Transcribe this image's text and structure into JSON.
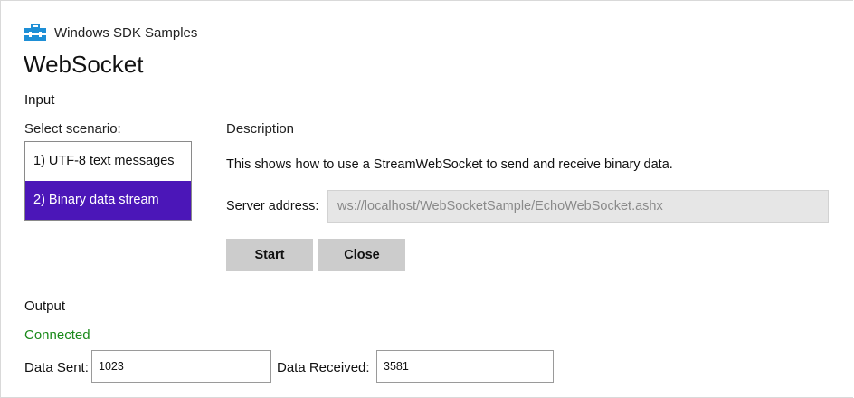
{
  "header": {
    "app_title": "Windows SDK Samples",
    "icon": "toolbox-icon",
    "page_title": "WebSocket"
  },
  "input": {
    "section_label": "Input",
    "scenario_label": "Select scenario:",
    "scenarios": [
      {
        "label": "1) UTF-8 text messages",
        "selected": false
      },
      {
        "label": "2) Binary data stream",
        "selected": true
      }
    ],
    "description_label": "Description",
    "description_text": "This shows how to use a StreamWebSocket to send and receive binary data.",
    "server_address_label": "Server address:",
    "server_address_value": "ws://localhost/WebSocketSample/EchoWebSocket.ashx",
    "start_label": "Start",
    "close_label": "Close"
  },
  "output": {
    "section_label": "Output",
    "status": "Connected",
    "data_sent_label": "Data Sent:",
    "data_sent_value": "1023",
    "data_received_label": "Data Received:",
    "data_received_value": "3581"
  },
  "colors": {
    "selected_bg": "#4b16b8",
    "status_green": "#1a8a1a",
    "icon_blue": "#1e8fd6"
  }
}
